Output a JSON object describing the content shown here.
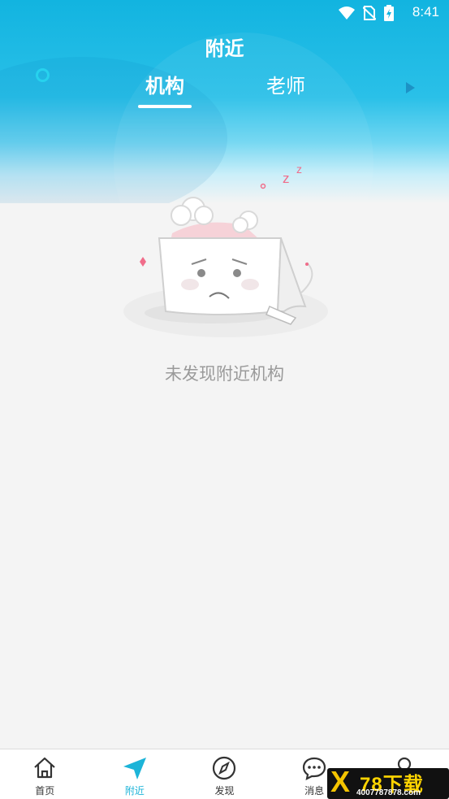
{
  "status_bar": {
    "time": "8:41"
  },
  "header": {
    "title": "附近",
    "tabs": [
      {
        "label": "机构",
        "active": true
      },
      {
        "label": "老师",
        "active": false
      }
    ]
  },
  "empty_state": {
    "message": "未发现附近机构"
  },
  "bottom_nav": {
    "items": [
      {
        "label": "首页",
        "icon": "home-icon",
        "active": false
      },
      {
        "label": "附近",
        "icon": "navigation-arrow-icon",
        "active": true
      },
      {
        "label": "发现",
        "icon": "compass-icon",
        "active": false
      },
      {
        "label": "消息",
        "icon": "chat-bubble-icon",
        "active": false
      },
      {
        "label": "",
        "icon": "user-icon",
        "active": false
      }
    ]
  },
  "watermark": {
    "brand": "78下载",
    "url": "4007787878.com"
  },
  "colors": {
    "accent": "#1cb4d8",
    "header": "#12b4e0"
  }
}
